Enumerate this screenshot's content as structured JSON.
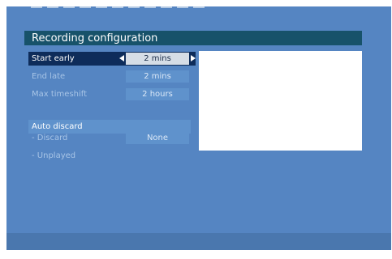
{
  "dialog": {
    "title": "Recording configuration"
  },
  "settings": [
    {
      "label": "Start early",
      "value": "2 mins",
      "selected": true
    },
    {
      "label": "End late",
      "value": "2 mins",
      "selected": false
    },
    {
      "label": "Max timeshift",
      "value": "2 hours",
      "selected": false
    }
  ],
  "auto_discard": {
    "header": "Auto discard",
    "items": [
      {
        "label": "- Discard",
        "value": "None"
      },
      {
        "label": "- Unplayed"
      }
    ]
  },
  "colors": {
    "background": "#5585c2",
    "title_bar": "#17526a",
    "selected_row": "#0e2c5a",
    "value_box": "#5f92cc",
    "preview_panel": "#ffffff"
  }
}
